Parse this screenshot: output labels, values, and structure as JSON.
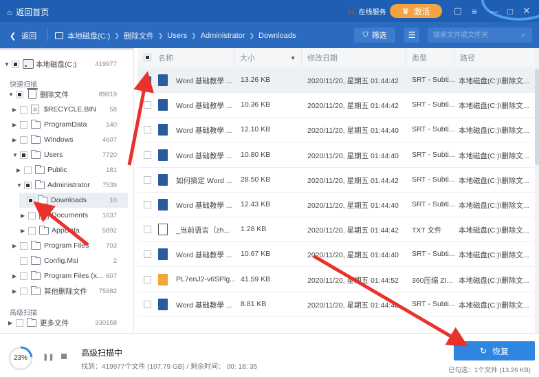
{
  "titlebar": {
    "home_label": "返回首页",
    "service_label": "在线服务",
    "activate_label": "激活"
  },
  "navbar": {
    "back_label": "返回",
    "breadcrumbs": [
      "本地磁盘(C:)",
      "删除文件",
      "Users",
      "Administrator",
      "Downloads"
    ],
    "filter_label": "筛选",
    "search_placeholder": "搜索文件或文件夹"
  },
  "sidebar": {
    "root": {
      "name": "本地磁盘(C:)",
      "count": "419977"
    },
    "quick_scan_label": "快速扫描",
    "advanced_scan_label": "高级扫描",
    "items": [
      {
        "name": "删除文件",
        "count": "89819"
      },
      {
        "name": "$RECYCLE.BIN",
        "count": "58"
      },
      {
        "name": "ProgramData",
        "count": "140"
      },
      {
        "name": "Windows",
        "count": "4607"
      },
      {
        "name": "Users",
        "count": "7720"
      },
      {
        "name": "Public",
        "count": "181"
      },
      {
        "name": "Administrator",
        "count": "7539"
      },
      {
        "name": "Downloads",
        "count": "10"
      },
      {
        "name": "Documents",
        "count": "1637"
      },
      {
        "name": "AppData",
        "count": "5892"
      },
      {
        "name": "Program Files",
        "count": "703"
      },
      {
        "name": "Config.Msi",
        "count": "2"
      },
      {
        "name": "Program Files (x...",
        "count": "607"
      },
      {
        "name": "其他删除文件",
        "count": "75982"
      },
      {
        "name": "更多文件",
        "count": "330158"
      }
    ]
  },
  "table": {
    "headers": {
      "name": "名称",
      "size": "大小",
      "date": "修改日期",
      "type": "类型",
      "path": "路径"
    },
    "rows": [
      {
        "name": "Word 基础教學 ...",
        "size": "13.26 KB",
        "date": "2020/11/20, 星期五 01:44:42",
        "type": "SRT - Subti...",
        "path": "本地磁盘(C:)\\删除文...",
        "icon": "srt",
        "checked": true
      },
      {
        "name": "Word 基础教學 ...",
        "size": "10.36 KB",
        "date": "2020/11/20, 星期五 01:44:42",
        "type": "SRT - Subti...",
        "path": "本地磁盘(C:)\\删除文...",
        "icon": "srt",
        "checked": false
      },
      {
        "name": "Word 基础教學 ...",
        "size": "12.10 KB",
        "date": "2020/11/20, 星期五 01:44:40",
        "type": "SRT - Subti...",
        "path": "本地磁盘(C:)\\删除文...",
        "icon": "srt",
        "checked": false
      },
      {
        "name": "Word 基础教學 ...",
        "size": "10.80 KB",
        "date": "2020/11/20, 星期五 01:44:40",
        "type": "SRT - Subti...",
        "path": "本地磁盘(C:)\\删除文...",
        "icon": "srt",
        "checked": false
      },
      {
        "name": "如何搞定 Word ...",
        "size": "28.50 KB",
        "date": "2020/11/20, 星期五 01:44:42",
        "type": "SRT - Subti...",
        "path": "本地磁盘(C:)\\删除文...",
        "icon": "srt",
        "checked": false
      },
      {
        "name": "Word 基础教學 ...",
        "size": "12.43 KB",
        "date": "2020/11/20, 星期五 01:44:40",
        "type": "SRT - Subti...",
        "path": "本地磁盘(C:)\\删除文...",
        "icon": "srt",
        "checked": false
      },
      {
        "name": "_当前语言（zh...",
        "size": "1.28 KB",
        "date": "2020/11/20, 星期五 01:44:42",
        "type": "TXT 文件",
        "path": "本地磁盘(C:)\\删除文...",
        "icon": "txt",
        "checked": false
      },
      {
        "name": "Word 基础教學 ...",
        "size": "10.67 KB",
        "date": "2020/11/20, 星期五 01:44:40",
        "type": "SRT - Subti...",
        "path": "本地磁盘(C:)\\删除文...",
        "icon": "srt",
        "checked": false
      },
      {
        "name": "PL7enJ2-v6SPlg...",
        "size": "41.59 KB",
        "date": "2020/11/20, 星期五 01:44:52",
        "type": "360压缩 ZI...",
        "path": "本地磁盘(C:)\\删除文...",
        "icon": "zip",
        "checked": false
      },
      {
        "name": "Word 基础教學 ...",
        "size": "8.81 KB",
        "date": "2020/11/20, 星期五 01:44:42",
        "type": "SRT - Subti...",
        "path": "本地磁盘(C:)\\删除文...",
        "icon": "srt",
        "checked": false
      }
    ]
  },
  "footer": {
    "progress_percent": 23,
    "progress_label": "23%",
    "scan_title": "高级扫描中",
    "scan_info": "找到：419977个文件 (107.79 GB) / 剩余时间：  00: 18: 35",
    "recover_label": "恢复",
    "selected_info": "已勾选：1个文件 (13.26 KB)"
  },
  "colors": {
    "titlebar": "#1e5fb4",
    "navbar": "#2a6bbf",
    "activate": "#f5a342",
    "recover": "#2f86e0",
    "annotation_arrow": "#e8322b"
  }
}
